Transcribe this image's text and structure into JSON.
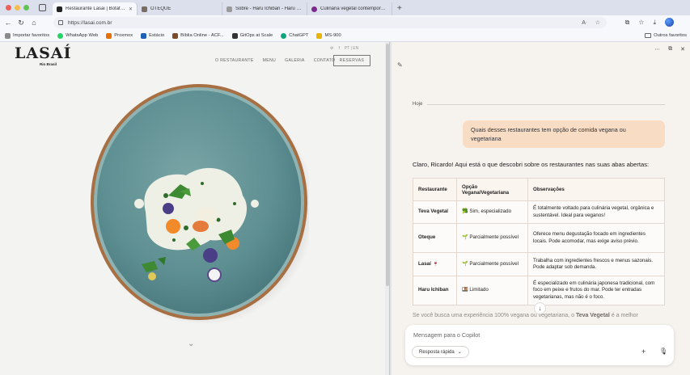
{
  "browser": {
    "tabs": [
      {
        "title": "Restaurante Lasai | Botafogo",
        "favicon_color": "#222222",
        "active": true
      },
      {
        "title": "OTEQUE",
        "favicon_color": "#7a6c61",
        "active": false
      },
      {
        "title": "Sobre - Haru Ichiban - Haru Ichiban",
        "favicon_color": "#9a9a9a",
        "active": false
      },
      {
        "title": "Culinária vegetal contemporânea",
        "favicon_color": "#7b2a8c",
        "active": false
      }
    ],
    "url": "https://lasai.com.br",
    "favorites": [
      {
        "label": "Importar favoritos",
        "color": "#8a8a8a"
      },
      {
        "label": "WhatsApp Web",
        "color": "#25d366"
      },
      {
        "label": "Proxmox",
        "color": "#e57000"
      },
      {
        "label": "Estácio",
        "color": "#1f5fb8"
      },
      {
        "label": "Bíblia Online - ACF...",
        "color": "#7a4a2a"
      },
      {
        "label": "GitOps at Scale",
        "color": "#333333"
      },
      {
        "label": "ChatGPT",
        "color": "#10a37f"
      },
      {
        "label": "MS-900",
        "color": "#e8b400"
      }
    ],
    "other_favorites": "Outros favoritos"
  },
  "site": {
    "logo": "LASAÍ",
    "logo_sub": "Rio Brasil",
    "nav": [
      "O RESTAURANTE",
      "MENU",
      "GALERIA",
      "CONTATO"
    ],
    "reserve_label": "RESERVAS",
    "top_icons": [
      "⚙",
      "f",
      "PT | EN"
    ],
    "accent": "#5e8f92"
  },
  "copilot": {
    "date_label": "Hoje",
    "user_message": "Quais desses restaurantes tem opção de comida vegana ou vegetariana",
    "reply_intro": "Claro, Ricardo! Aqui está o que descobri sobre os restaurantes nas suas abas abertas:",
    "table": {
      "headers": [
        "Restaurante",
        "Opção Vegana/Vegetariana",
        "Observações"
      ],
      "rows": [
        {
          "name": "Teva Vegetal",
          "option": "🥦 Sim, especializado",
          "notes": "É totalmente voltado para culinária vegetal, orgânica e sustentável. Ideal para veganos!"
        },
        {
          "name": "Oteque",
          "option": "🌱 Parcialmente possível",
          "notes": "Oferece menu degustação focado em ingredientes locais. Pode acomodar, mas exige aviso prévio."
        },
        {
          "name": "Lasaí 🍷",
          "option": "🌱 Parcialmente possível",
          "notes": "Trabalha com ingredientes frescos e menus sazonais. Pode adaptar sob demanda."
        },
        {
          "name": "Haru Ichiban",
          "option": "🍱 Limitado",
          "notes": "É especializado em culinária japonesa tradicional, com foco em peixe e frutos do mar. Pode ter entradas vegetarianas, mas não é o foco."
        }
      ]
    },
    "conclusion_pre": "Se você busca uma experiência 100% vegana ou vegetariana, o ",
    "conclusion_bold": "Teva Vegetal",
    "conclusion_post": " é a melhor",
    "composer_placeholder": "Mensagem para o Copilot",
    "quick_reply_label": "Resposta rápida",
    "user_bubble_color": "#f9dcc4"
  }
}
